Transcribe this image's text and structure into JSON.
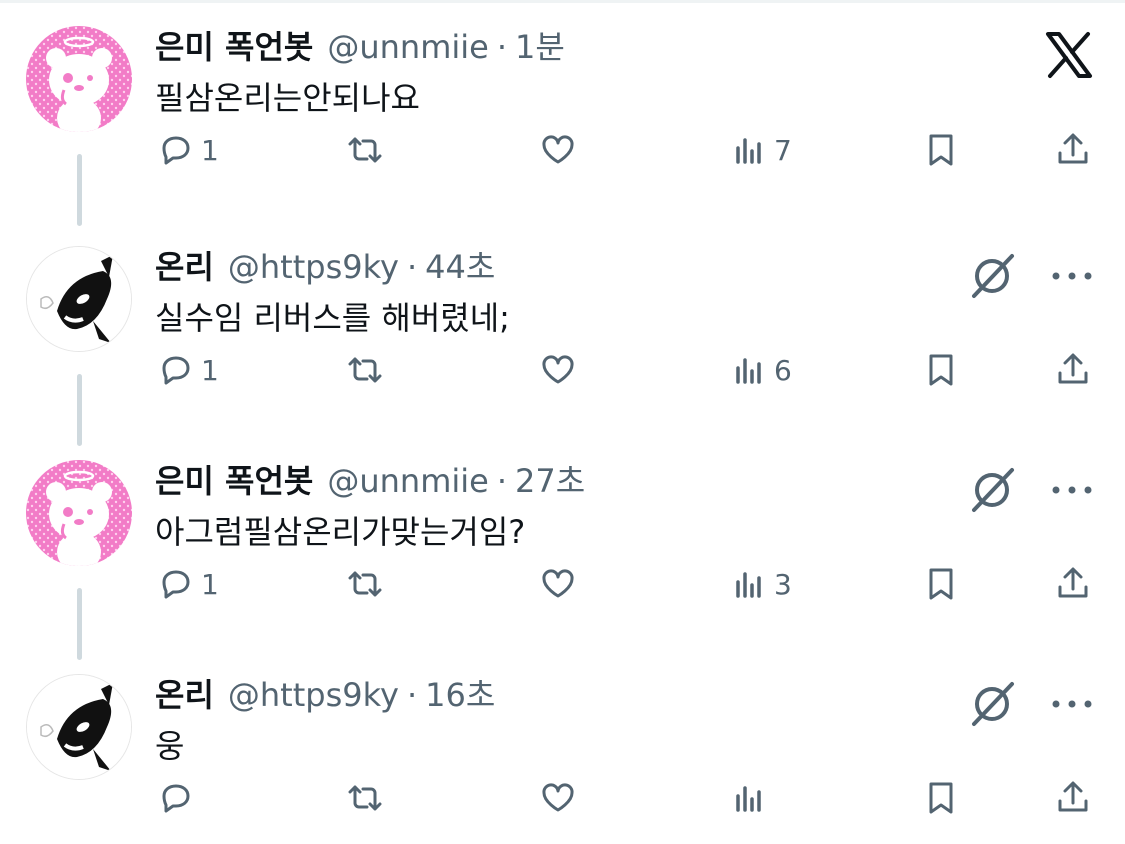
{
  "brand": {
    "logo_icon": "x-logo-icon",
    "accent": "#0f1419",
    "secondary_text": "#536471"
  },
  "tweets": [
    {
      "name": "은미 폭언봇",
      "handle": "@unnmiie",
      "dot": "·",
      "time": "1분",
      "text": "필삼온리는안되나요",
      "avatar": "pink-bear-avatar",
      "replies": "1",
      "reposts": "",
      "likes": "",
      "views": "7"
    },
    {
      "name": "온리",
      "handle": "@https9ky",
      "dot": "·",
      "time": "44초",
      "text": "실수임 리버스를 해버렸네;",
      "avatar": "orca-avatar",
      "replies": "1",
      "reposts": "",
      "likes": "",
      "views": "6"
    },
    {
      "name": "은미 폭언봇",
      "handle": "@unnmiie",
      "dot": "·",
      "time": "27초",
      "text": "아그럼필삼온리가맞는거임?",
      "avatar": "pink-bear-avatar",
      "replies": "1",
      "reposts": "",
      "likes": "",
      "views": "3"
    },
    {
      "name": "온리",
      "handle": "@https9ky",
      "dot": "·",
      "time": "16초",
      "text": "웅",
      "avatar": "orca-avatar",
      "replies": "",
      "reposts": "",
      "likes": "",
      "views": ""
    }
  ]
}
